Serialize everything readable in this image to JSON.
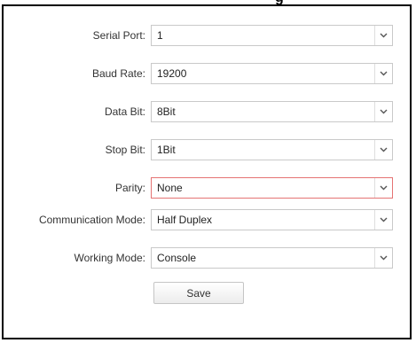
{
  "title_fragment": "g",
  "fields": [
    {
      "label": "Serial Port:",
      "value": "1"
    },
    {
      "label": "Baud Rate:",
      "value": "19200"
    },
    {
      "label": "Data Bit:",
      "value": "8Bit"
    },
    {
      "label": "Stop Bit:",
      "value": "1Bit"
    },
    {
      "label": "Parity:",
      "value": "None"
    },
    {
      "label": "Communication Mode:",
      "value": "Half Duplex"
    },
    {
      "label": "Working Mode:",
      "value": "Console"
    }
  ],
  "save_label": "Save",
  "icons": {
    "dropdown": "chevron-down-icon"
  },
  "colors": {
    "active_border": "#e57373",
    "border": "#c9c9c9",
    "panel_border": "#000000"
  }
}
